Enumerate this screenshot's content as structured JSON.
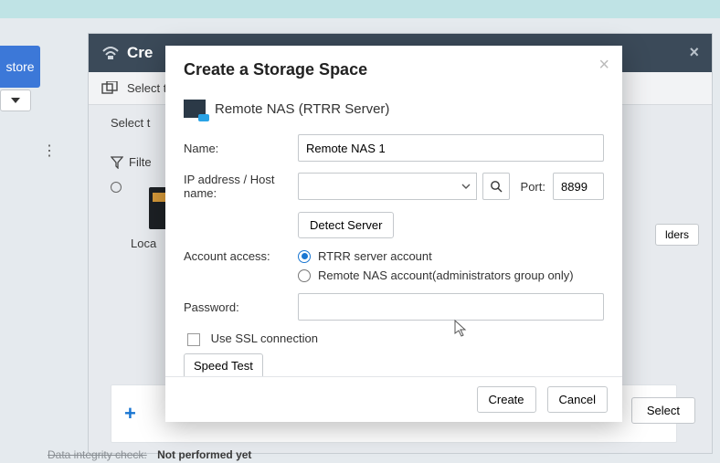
{
  "app": {
    "sidebar_stub": "store"
  },
  "win1": {
    "title_prefix": "Cre",
    "toolbar_select": "Select t",
    "body_select": "Select t",
    "filter_label": "Filte",
    "local_label": "Loca",
    "right_btn": "lders",
    "select_btn": "Select",
    "integrity_label": "Data integrity check:",
    "integrity_value": "Not performed yet"
  },
  "modal": {
    "title": "Create a Storage Space",
    "subtitle": "Remote NAS (RTRR Server)",
    "labels": {
      "name": "Name:",
      "ip": "IP address / Host name:",
      "port": "Port:",
      "detect": "Detect Server",
      "account": "Account access:",
      "radio_rtrr": "RTRR server account",
      "radio_remote": "Remote NAS account(administrators group only)",
      "password": "Password:",
      "ssl": "Use SSL connection",
      "speed": "Speed Test"
    },
    "values": {
      "name": "Remote NAS 1",
      "ip": "",
      "port": "8899",
      "password": ""
    },
    "buttons": {
      "create": "Create",
      "cancel": "Cancel"
    }
  }
}
